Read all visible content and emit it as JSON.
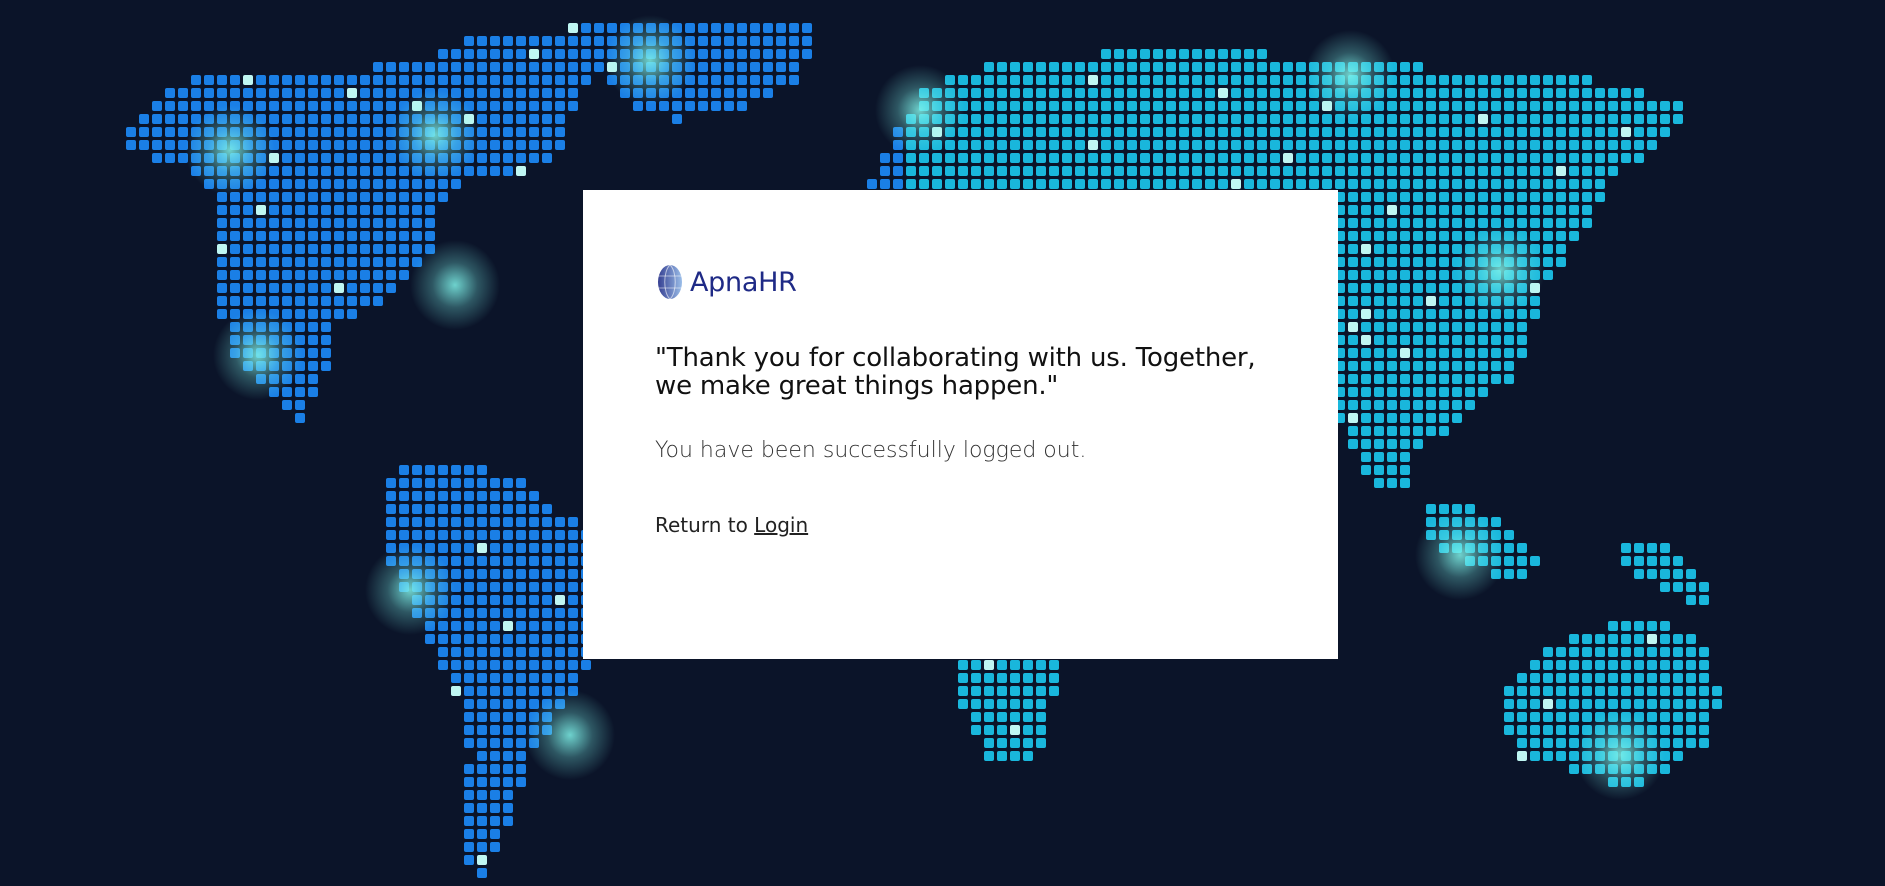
{
  "background": {
    "map_color_west": "#1a7fe6",
    "map_color_east": "#19b7dc",
    "glow_color": "#7ff3ea",
    "base_color": "#0b1429"
  },
  "logo": {
    "icon": "globe-logo-icon",
    "text": "ApnaHR",
    "color": "#1f2a86"
  },
  "message": {
    "quote": "\"Thank you for collaborating with us. Together, we make great things happen.\"",
    "status": "You have been successfully logged out."
  },
  "return": {
    "prefix": "Return to",
    "link_label": "Login"
  }
}
